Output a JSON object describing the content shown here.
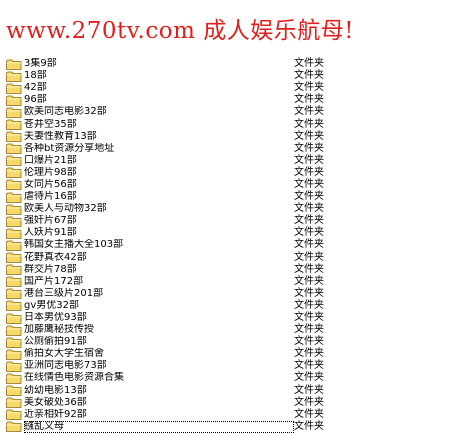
{
  "banner": {
    "text": "www.270tv.com 成人娱乐航母!",
    "color": "#e0201e"
  },
  "icon": {
    "name": "folder-icon",
    "fill": "#f6d96b",
    "stroke": "#8a6a13"
  },
  "folders": [
    {
      "name": "3集9部",
      "type": "文件夹"
    },
    {
      "name": "18部",
      "type": "文件夹"
    },
    {
      "name": "42部",
      "type": "文件夹"
    },
    {
      "name": "96部",
      "type": "文件夹"
    },
    {
      "name": "欧美同志电影32部",
      "type": "文件夹"
    },
    {
      "name": "苍井空35部",
      "type": "文件夹"
    },
    {
      "name": "夫妻性教育13部",
      "type": "文件夹"
    },
    {
      "name": "各种bt资源分享地址",
      "type": "文件夹"
    },
    {
      "name": "口爆片21部",
      "type": "文件夹"
    },
    {
      "name": "伦理片98部",
      "type": "文件夹"
    },
    {
      "name": "女同片56部",
      "type": "文件夹"
    },
    {
      "name": "虐待片16部",
      "type": "文件夹"
    },
    {
      "name": "欧美人与动物32部",
      "type": "文件夹"
    },
    {
      "name": "强奸片67部",
      "type": "文件夹"
    },
    {
      "name": "人妖片91部",
      "type": "文件夹"
    },
    {
      "name": "韩国女主播大全103部",
      "type": "文件夹"
    },
    {
      "name": "花野真衣42部",
      "type": "文件夹"
    },
    {
      "name": "群交片78部",
      "type": "文件夹"
    },
    {
      "name": "国产片172部",
      "type": "文件夹"
    },
    {
      "name": "港台三级片201部",
      "type": "文件夹"
    },
    {
      "name": "gv男优32部",
      "type": "文件夹"
    },
    {
      "name": "日本男优93部",
      "type": "文件夹"
    },
    {
      "name": "加藤鹰秘技传授",
      "type": "文件夹"
    },
    {
      "name": "公厕偷拍91部",
      "type": "文件夹"
    },
    {
      "name": "偷拍女大学生宿舍",
      "type": "文件夹"
    },
    {
      "name": "亚洲同志电影73部",
      "type": "文件夹"
    },
    {
      "name": "在线情色电影资源合集",
      "type": "文件夹"
    },
    {
      "name": "幼幼电影13部",
      "type": "文件夹"
    },
    {
      "name": "美女破处36部",
      "type": "文件夹"
    },
    {
      "name": "近亲相奸92部",
      "type": "文件夹"
    },
    {
      "name": "镪乱义母",
      "type": "文件夹"
    }
  ]
}
